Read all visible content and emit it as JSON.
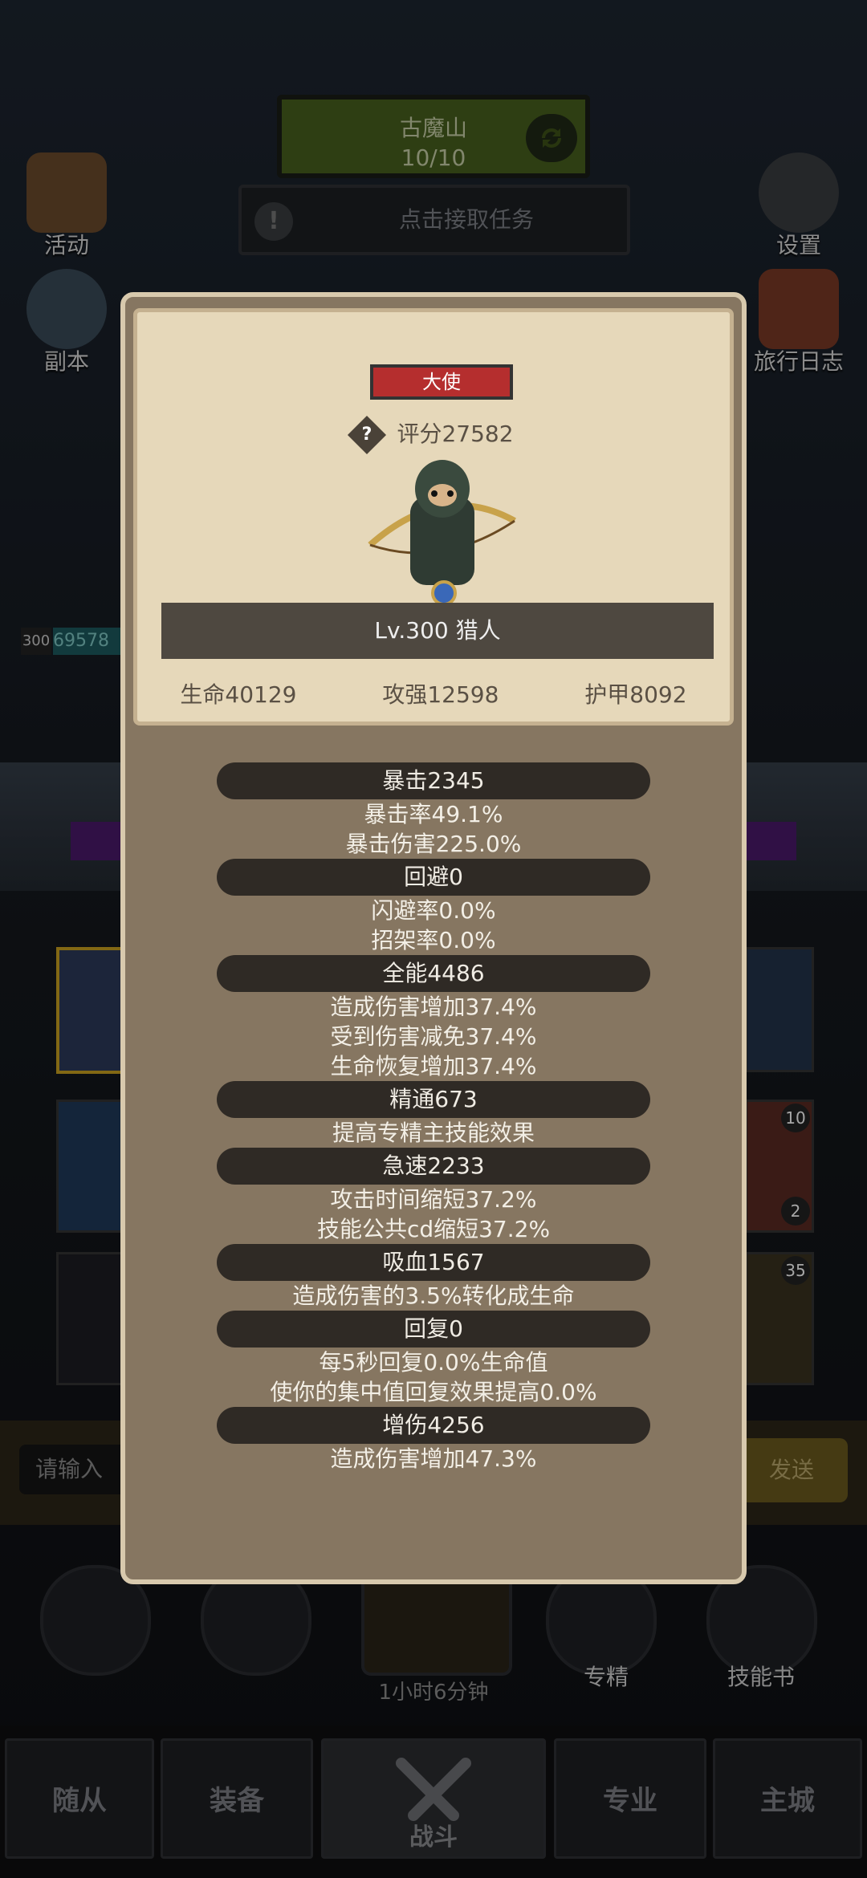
{
  "map": {
    "name": "古魔山",
    "progress": "10/10"
  },
  "task": {
    "label": "点击接取任务"
  },
  "side_buttons": {
    "activity": "活动",
    "dungeon": "副本",
    "settings": "设置",
    "travel_log": "旅行日志"
  },
  "background_hud": {
    "level_tag": "300",
    "number_partial": "69578"
  },
  "input": {
    "placeholder": "请输入",
    "send": "发送"
  },
  "skills": {
    "specialization": "专精",
    "skill_book": "技能书",
    "timer": "1小时6分钟"
  },
  "right_counts": [
    "10",
    "2",
    "35"
  ],
  "nav": {
    "tabs": [
      "随从",
      "装备",
      "战斗",
      "专业",
      "主城"
    ]
  },
  "hero": {
    "rank": "大使",
    "score_label": "评分27582",
    "level_class": "Lv.300 猎人",
    "hp": "生命40129",
    "attack": "攻强12598",
    "armor": "护甲8092"
  },
  "stats": [
    {
      "header": "暴击2345",
      "lines": [
        "暴击率49.1%",
        "暴击伤害225.0%"
      ]
    },
    {
      "header": "回避0",
      "lines": [
        "闪避率0.0%",
        "招架率0.0%"
      ]
    },
    {
      "header": "全能4486",
      "lines": [
        "造成伤害增加37.4%",
        "受到伤害减免37.4%",
        "生命恢复增加37.4%"
      ]
    },
    {
      "header": "精通673",
      "lines": [
        "提高专精主技能效果"
      ]
    },
    {
      "header": "急速2233",
      "lines": [
        "攻击时间缩短37.2%",
        "技能公共cd缩短37.2%"
      ]
    },
    {
      "header": "吸血1567",
      "lines": [
        "造成伤害的3.5%转化成生命"
      ]
    },
    {
      "header": "回复0",
      "lines": [
        "每5秒回复0.0%生命值",
        "使你的集中值回复效果提高0.0%"
      ]
    },
    {
      "header": "增伤4256",
      "lines": [
        "造成伤害增加47.3%"
      ]
    }
  ],
  "colors": {
    "rank_badge": "#b52e2e",
    "dialog_bg": "#867661",
    "card_bg": "#e6d8ba",
    "stat_header_bg": "#2f2a25"
  }
}
